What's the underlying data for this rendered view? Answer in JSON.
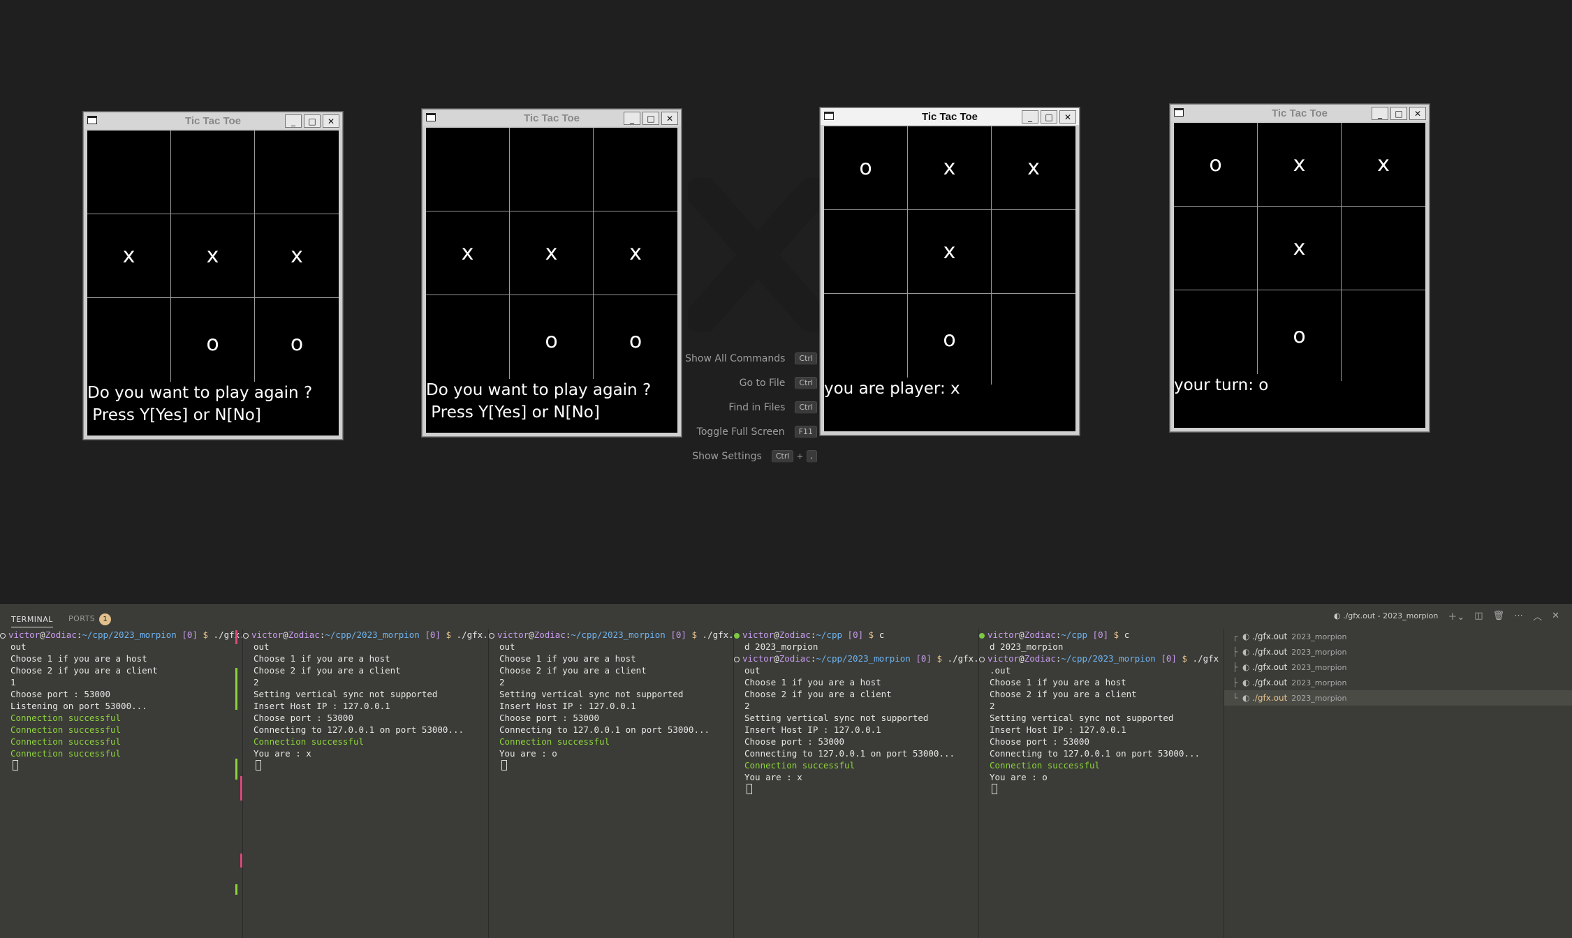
{
  "game_windows": [
    {
      "title": "Tic Tac Toe",
      "active": false,
      "board": [
        "",
        "",
        "",
        "x",
        "x",
        "x",
        "",
        "o",
        "o"
      ],
      "message": "Do you want to play again ?\n Press Y[Yes] or N[No]"
    },
    {
      "title": "Tic Tac Toe",
      "active": false,
      "board": [
        "",
        "",
        "",
        "x",
        "x",
        "x",
        "",
        "o",
        "o"
      ],
      "message": "Do you want to play again ?\n Press Y[Yes] or N[No]"
    },
    {
      "title": "Tic Tac Toe",
      "active": true,
      "board": [
        "o",
        "x",
        "x",
        "",
        "x",
        "",
        "",
        "o",
        ""
      ],
      "message": "you are player: x"
    },
    {
      "title": "Tic Tac Toe",
      "active": false,
      "board": [
        "o",
        "x",
        "x",
        "",
        "x",
        "",
        "",
        "o",
        ""
      ],
      "message": "your turn: o"
    }
  ],
  "window_controls": {
    "minimize": "_",
    "maximize": "□",
    "close": "✕"
  },
  "command_hints": [
    {
      "label": "Show All Commands",
      "keys": [
        "Ctrl"
      ]
    },
    {
      "label": "Go to File",
      "keys": [
        "Ctrl"
      ]
    },
    {
      "label": "Find in Files",
      "keys": [
        "Ctrl"
      ]
    },
    {
      "label": "Toggle Full Screen",
      "keys": [
        "F11"
      ]
    },
    {
      "label": "Show Settings",
      "keys": [
        "Ctrl",
        "+",
        ","
      ]
    }
  ],
  "panel": {
    "tabs": [
      {
        "label": "TERMINAL",
        "active": true
      },
      {
        "label": "PORTS",
        "badge": "1"
      }
    ],
    "active_terminal_title": "./gfx.out - 2023_morpion"
  },
  "terminals": [
    {
      "lines": [
        {
          "type": "prompt",
          "status": "circle",
          "user": "victor",
          "host": "Zodiac",
          "path": "~/cpp/2023_morpion",
          "code": "[0]",
          "cmd": "./gfx."
        },
        {
          "type": "text",
          "text": "out"
        },
        {
          "type": "text",
          "text": "Choose 1 if you are a host"
        },
        {
          "type": "text",
          "text": "Choose 2 if you are a client"
        },
        {
          "type": "text",
          "text": "1"
        },
        {
          "type": "text",
          "text": "Choose port : 53000"
        },
        {
          "type": "text",
          "text": "Listening on port 53000..."
        },
        {
          "type": "green",
          "text": "Connection successful"
        },
        {
          "type": "green",
          "text": "Connection successful"
        },
        {
          "type": "green",
          "text": "Connection successful"
        },
        {
          "type": "green",
          "text": "Connection successful"
        },
        {
          "type": "cursor"
        }
      ]
    },
    {
      "lines": [
        {
          "type": "prompt",
          "status": "circle",
          "user": "victor",
          "host": "Zodiac",
          "path": "~/cpp/2023_morpion",
          "code": "[0]",
          "cmd": "./gfx."
        },
        {
          "type": "text",
          "text": "out"
        },
        {
          "type": "text",
          "text": "Choose 1 if you are a host"
        },
        {
          "type": "text",
          "text": "Choose 2 if you are a client"
        },
        {
          "type": "text",
          "text": "2"
        },
        {
          "type": "text",
          "text": "Setting vertical sync not supported"
        },
        {
          "type": "text",
          "text": "Insert Host IP : 127.0.0.1"
        },
        {
          "type": "text",
          "text": "Choose port : 53000"
        },
        {
          "type": "text",
          "text": "Connecting to 127.0.0.1 on port 53000..."
        },
        {
          "type": "green",
          "text": "Connection successful"
        },
        {
          "type": "text",
          "text": "You are : x"
        },
        {
          "type": "cursor"
        }
      ]
    },
    {
      "lines": [
        {
          "type": "prompt",
          "status": "circle",
          "user": "victor",
          "host": "Zodiac",
          "path": "~/cpp/2023_morpion",
          "code": "[0]",
          "cmd": "./gfx."
        },
        {
          "type": "text",
          "text": "out"
        },
        {
          "type": "text",
          "text": "Choose 1 if you are a host"
        },
        {
          "type": "text",
          "text": "Choose 2 if you are a client"
        },
        {
          "type": "text",
          "text": "2"
        },
        {
          "type": "text",
          "text": "Setting vertical sync not supported"
        },
        {
          "type": "text",
          "text": "Insert Host IP : 127.0.0.1"
        },
        {
          "type": "text",
          "text": "Choose port : 53000"
        },
        {
          "type": "text",
          "text": "Connecting to 127.0.0.1 on port 53000..."
        },
        {
          "type": "green",
          "text": "Connection successful"
        },
        {
          "type": "text",
          "text": "You are : o"
        },
        {
          "type": "cursor"
        }
      ]
    },
    {
      "lines": [
        {
          "type": "prompt",
          "status": "ok",
          "user": "victor",
          "host": "Zodiac",
          "path": "~/cpp",
          "code": "[0]",
          "cmd": "c"
        },
        {
          "type": "text",
          "text": "d 2023_morpion"
        },
        {
          "type": "prompt",
          "status": "circle",
          "user": "victor",
          "host": "Zodiac",
          "path": "~/cpp/2023_morpion",
          "code": "[0]",
          "cmd": "./gfx."
        },
        {
          "type": "text",
          "text": "out"
        },
        {
          "type": "text",
          "text": "Choose 1 if you are a host"
        },
        {
          "type": "text",
          "text": "Choose 2 if you are a client"
        },
        {
          "type": "text",
          "text": "2"
        },
        {
          "type": "text",
          "text": "Setting vertical sync not supported"
        },
        {
          "type": "text",
          "text": "Insert Host IP : 127.0.0.1"
        },
        {
          "type": "text",
          "text": "Choose port : 53000"
        },
        {
          "type": "text",
          "text": "Connecting to 127.0.0.1 on port 53000..."
        },
        {
          "type": "green",
          "text": "Connection successful"
        },
        {
          "type": "text",
          "text": "You are : x"
        },
        {
          "type": "cursor"
        }
      ]
    },
    {
      "lines": [
        {
          "type": "prompt",
          "status": "ok",
          "user": "victor",
          "host": "Zodiac",
          "path": "~/cpp",
          "code": "[0]",
          "cmd": "c"
        },
        {
          "type": "text",
          "text": "d 2023_morpion"
        },
        {
          "type": "prompt",
          "status": "circle",
          "user": "victor",
          "host": "Zodiac",
          "path": "~/cpp/2023_morpion",
          "code": "[0]",
          "cmd": "./gfx"
        },
        {
          "type": "text",
          "text": ".out"
        },
        {
          "type": "text",
          "text": "Choose 1 if you are a host"
        },
        {
          "type": "text",
          "text": "Choose 2 if you are a client"
        },
        {
          "type": "text",
          "text": "2"
        },
        {
          "type": "text",
          "text": "Setting vertical sync not supported"
        },
        {
          "type": "text",
          "text": "Insert Host IP : 127.0.0.1"
        },
        {
          "type": "text",
          "text": "Choose port : 53000"
        },
        {
          "type": "text",
          "text": "Connecting to 127.0.0.1 on port 53000..."
        },
        {
          "type": "green",
          "text": "Connection successful"
        },
        {
          "type": "text",
          "text": "You are : o"
        },
        {
          "type": "cursor"
        }
      ]
    }
  ],
  "terminal_list": [
    {
      "name": "./gfx.out",
      "dir": "2023_morpion",
      "selected": false
    },
    {
      "name": "./gfx.out",
      "dir": "2023_morpion",
      "selected": false
    },
    {
      "name": "./gfx.out",
      "dir": "2023_morpion",
      "selected": false
    },
    {
      "name": "./gfx.out",
      "dir": "2023_morpion",
      "selected": false
    },
    {
      "name": "./gfx.out",
      "dir": "2023_morpion",
      "selected": true
    }
  ],
  "colors": {
    "accent_green": "#8cd23c",
    "user_purple": "#c89bf0",
    "path_blue": "#6fb3f0",
    "badge": "#e2c08d"
  }
}
